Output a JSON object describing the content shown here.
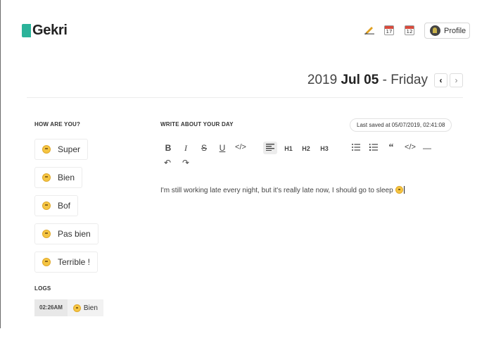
{
  "app": {
    "name": "Gekri"
  },
  "header": {
    "icons": [
      {
        "name": "pencil-icon"
      },
      {
        "name": "calendar-17-icon",
        "day": "17"
      },
      {
        "name": "calendar-12-icon",
        "day": "12"
      }
    ],
    "profile_label": "Profile"
  },
  "date": {
    "year": "2019",
    "month_day": "Jul 05",
    "separator": "-",
    "weekday": "Friday",
    "prev_symbol": "‹",
    "next_symbol": "›"
  },
  "mood_section": {
    "title": "HOW ARE YOU?",
    "options": [
      {
        "label": "Super"
      },
      {
        "label": "Bien"
      },
      {
        "label": "Bof"
      },
      {
        "label": "Pas bien"
      },
      {
        "label": "Terrible !"
      }
    ]
  },
  "logs": {
    "title": "LOGS",
    "entries": [
      {
        "time": "02:26AM",
        "mood": "Bien"
      }
    ]
  },
  "editor": {
    "title": "WRITE ABOUT YOUR DAY",
    "last_saved": "Last saved at 05/07/2019, 02:41:08",
    "toolbar": {
      "bold": "B",
      "italic": "I",
      "strike": "S",
      "underline": "U",
      "code": "</>",
      "h1": "H1",
      "h2": "H2",
      "h3": "H3",
      "quote": "66",
      "code_block": "</>",
      "hr": "—",
      "undo": "↶",
      "redo": "↷"
    },
    "content": "I'm still working late every night, but it's really late now, I should go to sleep"
  },
  "colors": {
    "brand": "#2bb39a",
    "calendar_red": "#d94a3c"
  }
}
